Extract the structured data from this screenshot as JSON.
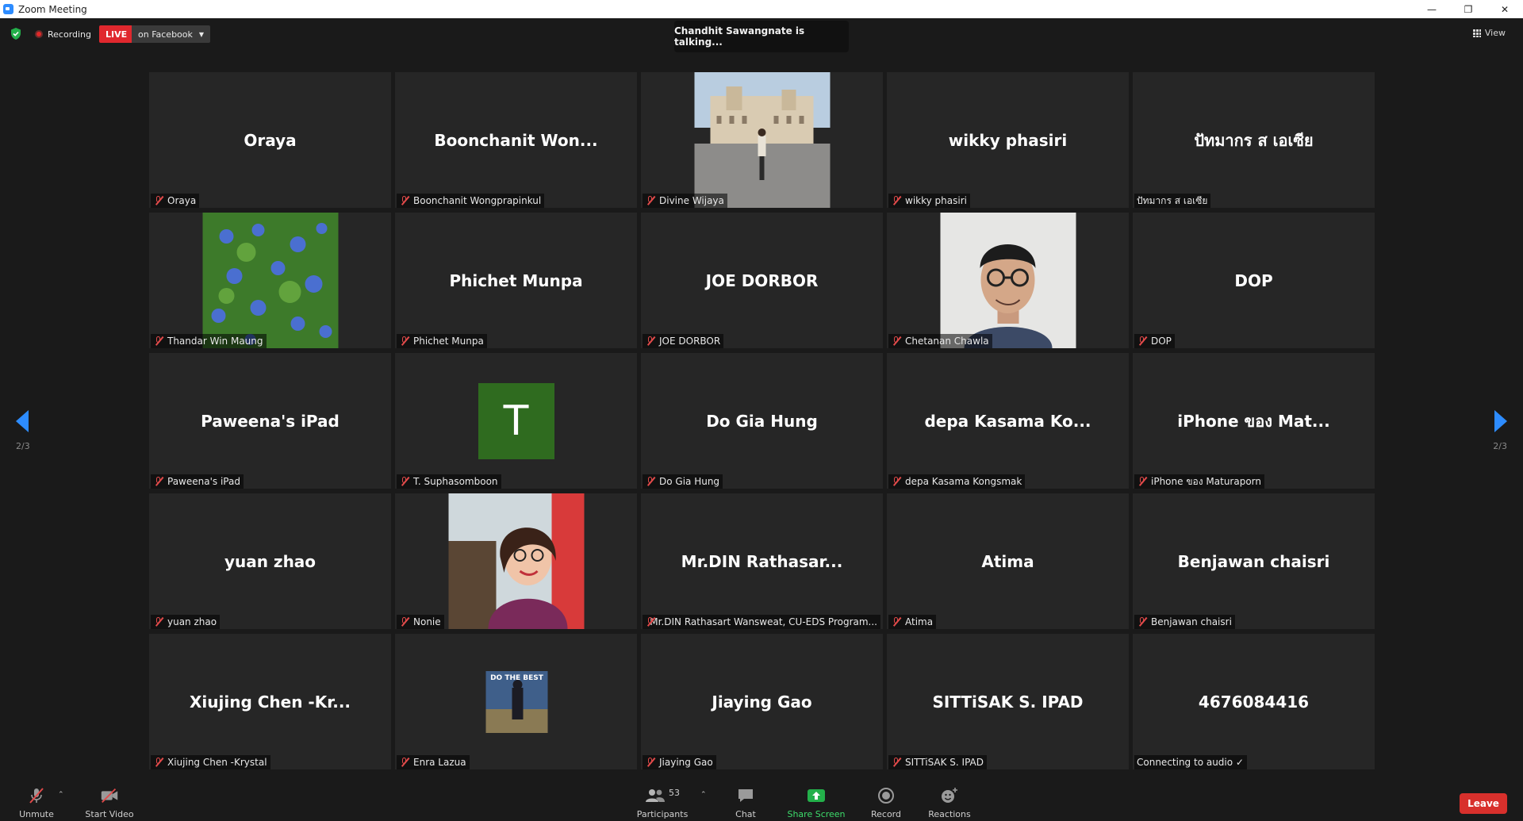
{
  "window": {
    "title": "Zoom Meeting"
  },
  "topbar": {
    "recording_label": "Recording",
    "live_label": "LIVE",
    "stream_label": "on Facebook",
    "talking_text": "Chandhit Sawangnate is talking...",
    "view_label": "View"
  },
  "pagination": {
    "left": "2/3",
    "right": "2/3"
  },
  "tiles": [
    {
      "big": "Oraya",
      "label": "Oraya",
      "muted": true
    },
    {
      "big": "Boonchanit  Won...",
      "label": "Boonchanit Wongprapinkul",
      "muted": true
    },
    {
      "big": "",
      "label": "Divine Wijaya",
      "muted": true,
      "video": "city-square-photo"
    },
    {
      "big": "wikky phasiri",
      "label": "wikky phasiri",
      "muted": true
    },
    {
      "big": "ปัทมากร   ส เอเซีย",
      "label": "ปัทมากร   ส เอเซีย",
      "muted": false
    },
    {
      "big": "",
      "label": "Thandar Win Maung",
      "muted": true,
      "video": "flowers-photo"
    },
    {
      "big": "Phichet Munpa",
      "label": "Phichet Munpa",
      "muted": true
    },
    {
      "big": "JOE DORBOR",
      "label": "JOE DORBOR",
      "muted": true
    },
    {
      "big": "",
      "label": "Chetanan Chawla",
      "muted": true,
      "video": "man-portrait-photo"
    },
    {
      "big": "DOP",
      "label": "DOP",
      "muted": true
    },
    {
      "big": "Paweena's iPad",
      "label": "Paweena's iPad",
      "muted": true
    },
    {
      "big": "",
      "label": "T. Suphasomboon",
      "muted": true,
      "avatar_letter": "T"
    },
    {
      "big": "Do Gia Hung",
      "label": "Do Gia Hung",
      "muted": true
    },
    {
      "big": "depa Kasama Ko...",
      "label": "depa Kasama Kongsmak",
      "muted": true
    },
    {
      "big": "iPhone ของ Mat...",
      "label": "iPhone ของ Maturaporn",
      "muted": true
    },
    {
      "big": "yuan zhao",
      "label": "yuan zhao",
      "muted": true
    },
    {
      "big": "",
      "label": "Nonie",
      "muted": true,
      "video": "woman-selfie-photo"
    },
    {
      "big": "Mr.DIN  Rathasar...",
      "label": "Mr.DIN Rathasart Wansweat, CU-EDS Program...",
      "muted": true
    },
    {
      "big": "Atima",
      "label": "Atima",
      "muted": true
    },
    {
      "big": "Benjawan chaisri",
      "label": "Benjawan chaisri",
      "muted": true
    },
    {
      "big": "Xiujing  Chen  -Kr...",
      "label": "Xiujing Chen -Krystal",
      "muted": true
    },
    {
      "big": "",
      "label": "Enra Lazua",
      "muted": true,
      "video": "do-the-best-photo",
      "video_caption": "DO THE BEST"
    },
    {
      "big": "Jiaying Gao",
      "label": "Jiaying Gao",
      "muted": true
    },
    {
      "big": "SITTiSAK S. IPAD",
      "label": "SITTiSAK S. IPAD",
      "muted": true
    },
    {
      "big": "4676084416",
      "label": "Connecting to audio ✓",
      "muted": false
    }
  ],
  "toolbar": {
    "unmute": "Unmute",
    "start_video": "Start Video",
    "participants": "Participants",
    "participant_count": "53",
    "chat": "Chat",
    "share_screen": "Share Screen",
    "record": "Record",
    "reactions": "Reactions",
    "leave": "Leave"
  },
  "colors": {
    "accent": "#2d8cff",
    "live": "#e0282e",
    "share": "#3ddc6b",
    "leave": "#d8302c",
    "muted_mic": "#e24a4a",
    "avatar_bg": "#2f6b1f"
  }
}
